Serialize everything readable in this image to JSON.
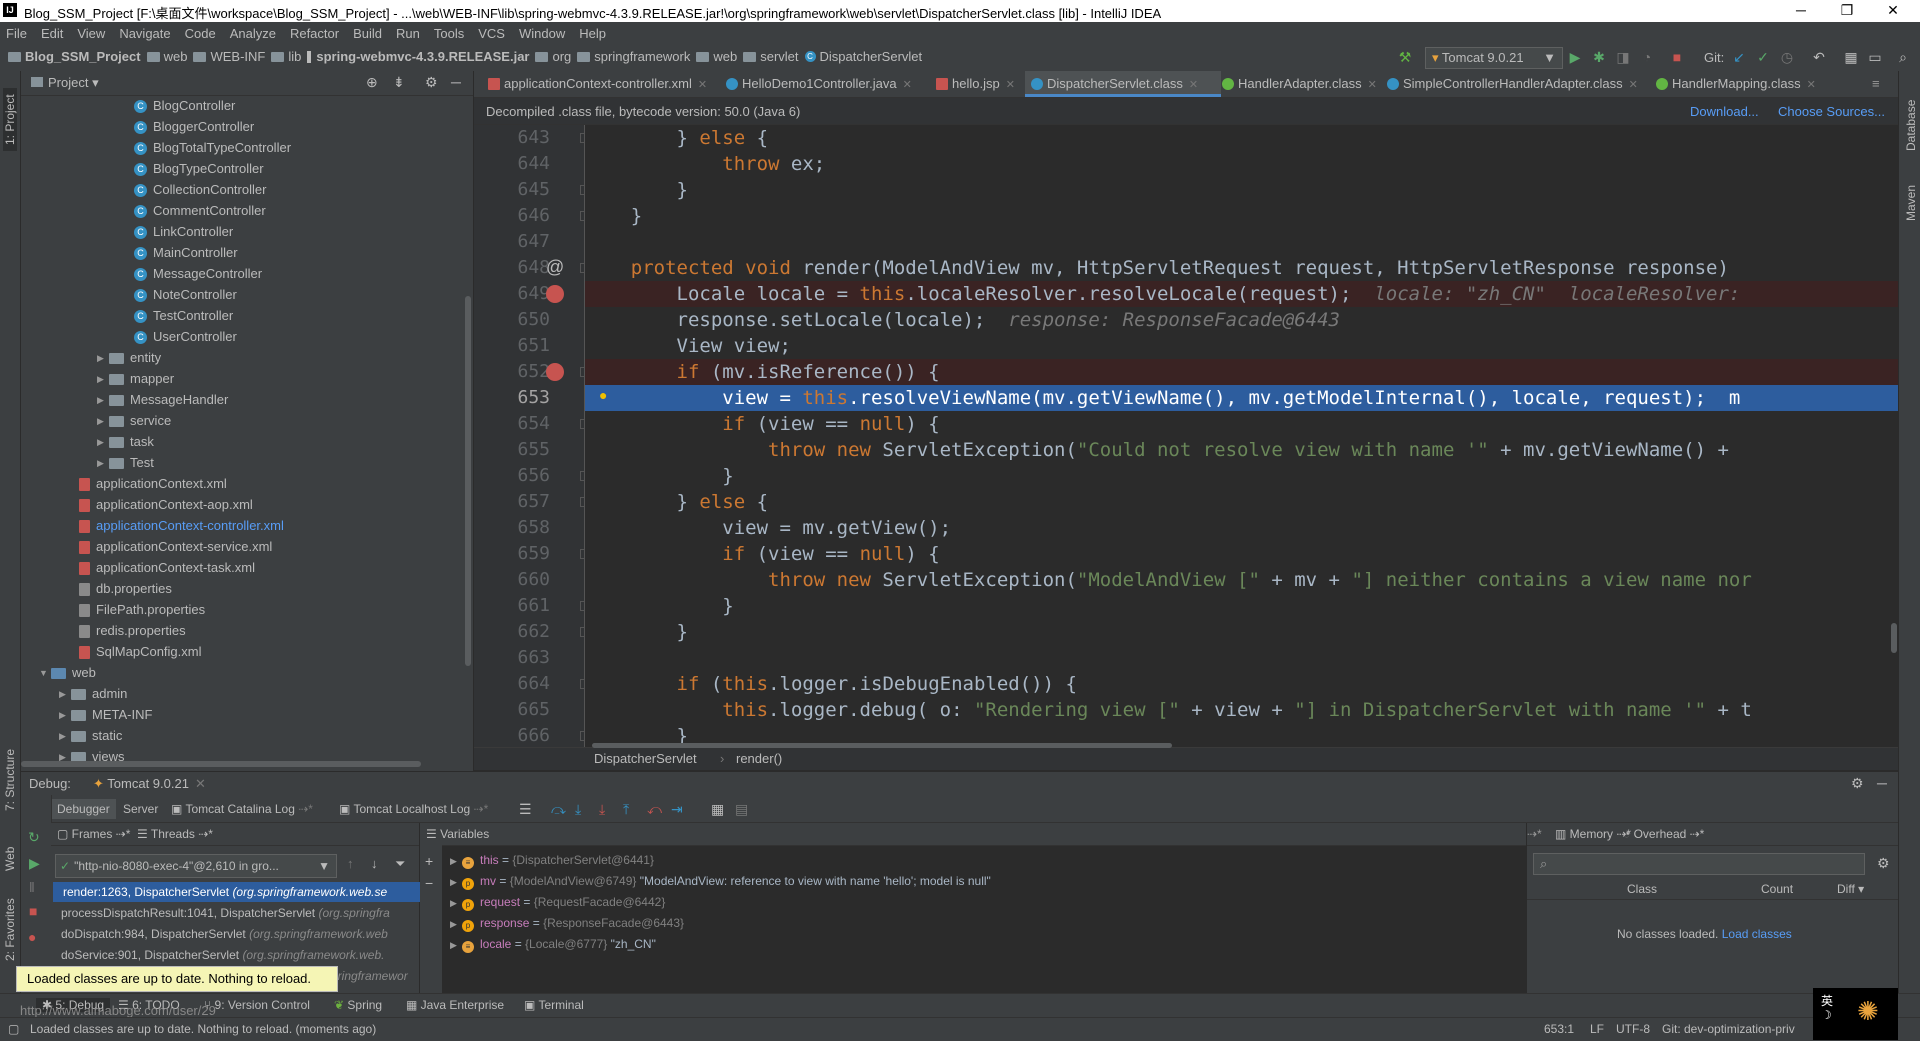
{
  "window": {
    "title": "Blog_SSM_Project [F:\\桌面文件\\workspace\\Blog_SSM_Project] - ...\\web\\WEB-INF\\lib\\spring-webmvc-4.3.9.RELEASE.jar!\\org\\springframework\\web\\servlet\\DispatcherServlet.class [lib] - IntelliJ IDEA",
    "minimize": "─",
    "restore": "❐",
    "close": "✕"
  },
  "menu": [
    "File",
    "Edit",
    "View",
    "Navigate",
    "Code",
    "Analyze",
    "Refactor",
    "Build",
    "Run",
    "Tools",
    "VCS",
    "Window",
    "Help"
  ],
  "nav": {
    "crumbs": [
      "Blog_SSM_Project",
      "web",
      "WEB-INF",
      "lib",
      "spring-webmvc-4.3.9.RELEASE.jar",
      "org",
      "springframework",
      "web",
      "servlet",
      "DispatcherServlet"
    ],
    "run_config": "Tomcat 9.0.21",
    "git_label": "Git:"
  },
  "left_stripe": {
    "project": "1: Project",
    "structure": "7: Structure",
    "web": "Web",
    "favorites": "2: Favorites"
  },
  "right_stripe": {
    "database": "Database",
    "maven": "Maven"
  },
  "project": {
    "title": "Project",
    "items": [
      {
        "label": "BlogController",
        "type": "class"
      },
      {
        "label": "BloggerController",
        "type": "class"
      },
      {
        "label": "BlogTotalTypeController",
        "type": "class"
      },
      {
        "label": "BlogTypeController",
        "type": "class"
      },
      {
        "label": "CollectionController",
        "type": "class"
      },
      {
        "label": "CommentController",
        "type": "class"
      },
      {
        "label": "LinkController",
        "type": "class"
      },
      {
        "label": "MainController",
        "type": "class"
      },
      {
        "label": "MessageController",
        "type": "class"
      },
      {
        "label": "NoteController",
        "type": "class"
      },
      {
        "label": "TestController",
        "type": "class"
      },
      {
        "label": "UserController",
        "type": "class"
      },
      {
        "label": "entity",
        "type": "folder"
      },
      {
        "label": "mapper",
        "type": "folder"
      },
      {
        "label": "MessageHandler",
        "type": "folder"
      },
      {
        "label": "service",
        "type": "folder"
      },
      {
        "label": "task",
        "type": "folder"
      },
      {
        "label": "Test",
        "type": "folder"
      },
      {
        "label": "applicationContext.xml",
        "type": "xml"
      },
      {
        "label": "applicationContext-aop.xml",
        "type": "xml"
      },
      {
        "label": "applicationContext-controller.xml",
        "type": "xml-active"
      },
      {
        "label": "applicationContext-service.xml",
        "type": "xml"
      },
      {
        "label": "applicationContext-task.xml",
        "type": "xml"
      },
      {
        "label": "db.properties",
        "type": "props"
      },
      {
        "label": "FilePath.properties",
        "type": "props"
      },
      {
        "label": "redis.properties",
        "type": "props"
      },
      {
        "label": "SqlMapConfig.xml",
        "type": "xml"
      },
      {
        "label": "web",
        "type": "folder-open"
      },
      {
        "label": "admin",
        "type": "subfolder"
      },
      {
        "label": "META-INF",
        "type": "subfolder"
      },
      {
        "label": "static",
        "type": "subfolder"
      },
      {
        "label": "views",
        "type": "subfolder"
      }
    ]
  },
  "tabs": [
    {
      "label": "applicationContext-controller.xml",
      "color": "#c75450"
    },
    {
      "label": "HelloDemo1Controller.java",
      "color": "#3592c4"
    },
    {
      "label": "hello.jsp",
      "color": "#c75450"
    },
    {
      "label": "DispatcherServlet.class",
      "color": "#3592c4",
      "active": true
    },
    {
      "label": "HandlerAdapter.class",
      "color": "#62b543"
    },
    {
      "label": "SimpleControllerHandlerAdapter.class",
      "color": "#3592c4"
    },
    {
      "label": "HandlerMapping.class",
      "color": "#62b543"
    }
  ],
  "infobar": {
    "message": "Decompiled .class file, bytecode version: 50.0 (Java 6)",
    "download": "Download...",
    "choose_sources": "Choose Sources..."
  },
  "code_lines": [
    {
      "n": "643",
      "html": "        } <k>else</k> {"
    },
    {
      "n": "644",
      "html": "            <k>throw</k> ex;"
    },
    {
      "n": "645",
      "html": "        }"
    },
    {
      "n": "646",
      "html": "    }"
    },
    {
      "n": "647",
      "html": ""
    },
    {
      "n": "648",
      "html": "    <k>protected void</k> render(ModelAndView mv, HttpServletRequest request, HttpServletResponse response)"
    },
    {
      "n": "649",
      "html": "        Locale locale = <k>this</k>.localeResolver.resolveLocale(request);  <i>locale: \"zh_CN\"  localeResolver:</i>"
    },
    {
      "n": "650",
      "html": "        response.setLocale(locale);  <i>response: ResponseFacade@6443</i>"
    },
    {
      "n": "651",
      "html": "        View view;"
    },
    {
      "n": "652",
      "html": "        <k>if</k> (mv.isReference()) {"
    },
    {
      "n": "653",
      "html": "            view = <k>this</k>.resolveViewName(mv.getViewName(), mv.getModelInternal(), locale, request);  m"
    },
    {
      "n": "654",
      "html": "            <k>if</k> (view == <k>null</k>) {"
    },
    {
      "n": "655",
      "html": "                <k>throw new</k> ServletException(<s>\"Could not resolve view with name '\"</s> + mv.getViewName() +"
    },
    {
      "n": "656",
      "html": "            }"
    },
    {
      "n": "657",
      "html": "        } <k>else</k> {"
    },
    {
      "n": "658",
      "html": "            view = mv.getView();"
    },
    {
      "n": "659",
      "html": "            <k>if</k> (view == <k>null</k>) {"
    },
    {
      "n": "660",
      "html": "                <k>throw new</k> ServletException(<s>\"ModelAndView [\"</s> + mv + <s>\"] neither contains a view name nor</s>"
    },
    {
      "n": "661",
      "html": "            }"
    },
    {
      "n": "662",
      "html": "        }"
    },
    {
      "n": "663",
      "html": ""
    },
    {
      "n": "664",
      "html": "        <k>if</k> (<k>this</k>.logger.isDebugEnabled()) {"
    },
    {
      "n": "665",
      "html": "            <k>this</k>.logger.debug( o: <s>\"Rendering view [\"</s> + view + <s>\"] in DispatcherServlet with name '\"</s> + t"
    },
    {
      "n": "666",
      "html": "        }"
    }
  ],
  "editor_crumb": {
    "class": "DispatcherServlet",
    "method": "render()"
  },
  "debug": {
    "label": "Debug:",
    "session": "Tomcat 9.0.21",
    "tabs": [
      "Debugger",
      "Server",
      "Tomcat Catalina Log",
      "Tomcat Localhost Log"
    ],
    "frames_label": "Frames",
    "threads_label": "Threads",
    "thread": "\"http-nio-8080-exec-4\"@2,610 in gro...",
    "frames": [
      {
        "method": "render:1263, DispatcherServlet",
        "pkg": "(org.springframework.web.se"
      },
      {
        "method": "processDispatchResult:1041, DispatcherServlet",
        "pkg": "(org.springfra"
      },
      {
        "method": "doDispatch:984, DispatcherServlet",
        "pkg": "(org.springframework.web"
      },
      {
        "method": "doService:901, DispatcherServlet",
        "pkg": "(org.springframework.web."
      },
      {
        "method": "",
        "pkg": "pringframewor"
      }
    ],
    "variables_label": "Variables",
    "variables": [
      {
        "name": "this",
        "type": "{DispatcherServlet@6441}",
        "value": ""
      },
      {
        "name": "mv",
        "type": "{ModelAndView@6749}",
        "value": "\"ModelAndView: reference to view with name 'hello'; model is null\""
      },
      {
        "name": "request",
        "type": "{RequestFacade@6442}",
        "value": ""
      },
      {
        "name": "response",
        "type": "{ResponseFacade@6443}",
        "value": ""
      },
      {
        "name": "locale",
        "type": "{Locale@6777}",
        "value": "\"zh_CN\""
      }
    ],
    "memory_label": "Memory",
    "overhead_label": "Overhead",
    "mem_cols": [
      "Class",
      "Count",
      "Diff"
    ],
    "no_classes": "No classes loaded.",
    "load_classes": "Load classes"
  },
  "tooltip": "Loaded classes are up to date. Nothing to reload.",
  "watermark": "http://www.aimaboge.com/user/29",
  "bottom_tabs": [
    "5: Debug",
    "6: TODO",
    "9: Version Control",
    "Spring",
    "Java Enterprise",
    "Terminal"
  ],
  "status": {
    "message": "Loaded classes are up to date. Nothing to reload. (moments ago)",
    "position": "653:1",
    "line_sep": "LF",
    "encoding": "UTF-8",
    "git": "Git: dev-optimization-priv"
  },
  "ime": {
    "lang": "英"
  }
}
